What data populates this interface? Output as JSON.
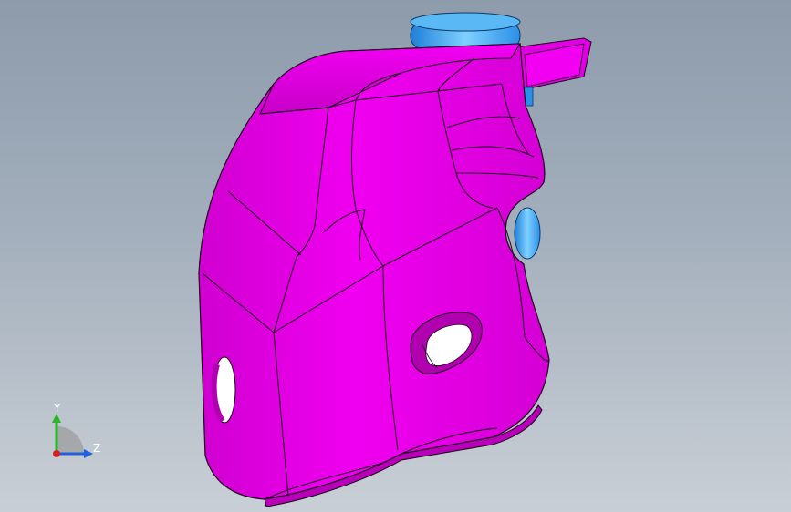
{
  "viewport": {
    "name": "3d-model-viewport",
    "background_top": "#8d9bab",
    "background_bottom": "#c9cfd6"
  },
  "model": {
    "body_color": "#e100e1",
    "body_shade": "#c000c0",
    "edge_color": "#1a001a",
    "accent_color": "#2a8fe6"
  },
  "triad": {
    "y_label": "Y",
    "z_label": "Z",
    "y_color": "#2bb52b",
    "z_color": "#1f5fe0",
    "x_color": "#d42020"
  }
}
